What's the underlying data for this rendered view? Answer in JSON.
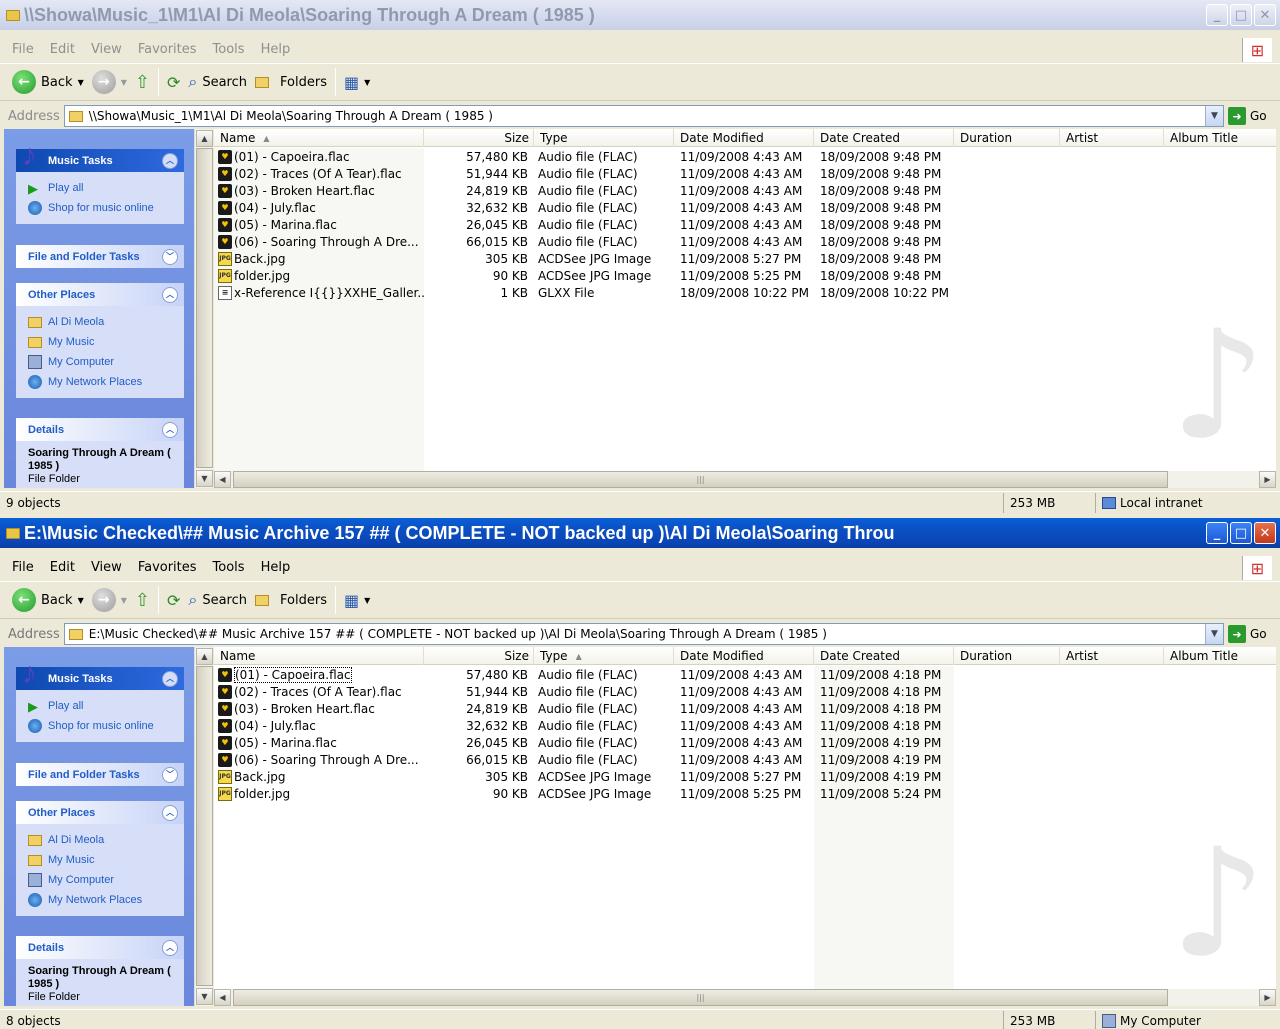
{
  "windows": [
    {
      "title": "\\\\Showa\\Music_1\\M1\\Al Di Meola\\Soaring Through A Dream  ( 1985 )",
      "state": "inactive",
      "menu": [
        "File",
        "Edit",
        "View",
        "Favorites",
        "Tools",
        "Help"
      ],
      "toolbar": {
        "back": "Back",
        "search": "Search",
        "folders": "Folders"
      },
      "address_label": "Address",
      "address": "\\\\Showa\\Music_1\\M1\\Al Di Meola\\Soaring Through A Dream  ( 1985 )",
      "go": "Go",
      "tasks": {
        "music_tasks": "Music Tasks",
        "play_all": "Play all",
        "shop": "Shop for music online",
        "file_folder_tasks": "File and Folder Tasks",
        "other_places": "Other Places",
        "places": [
          "Al Di Meola",
          "My Music",
          "My Computer",
          "My Network Places"
        ],
        "details": "Details",
        "detail_title": "Soaring Through A Dream  ( 1985 )",
        "detail_sub": "File Folder"
      },
      "columns": [
        "Name",
        "Size",
        "Type",
        "Date Modified",
        "Date Created",
        "Duration",
        "Artist",
        "Album Title"
      ],
      "files": [
        {
          "name": "(01) - Capoeira.flac",
          "size": "57,480 KB",
          "type": "Audio file (FLAC)",
          "modified": "11/09/2008 4:43 AM",
          "created": "18/09/2008 9:48 PM",
          "icon": "flac"
        },
        {
          "name": "(02) - Traces (Of A Tear).flac",
          "size": "51,944 KB",
          "type": "Audio file (FLAC)",
          "modified": "11/09/2008 4:43 AM",
          "created": "18/09/2008 9:48 PM",
          "icon": "flac"
        },
        {
          "name": "(03) - Broken Heart.flac",
          "size": "24,819 KB",
          "type": "Audio file (FLAC)",
          "modified": "11/09/2008 4:43 AM",
          "created": "18/09/2008 9:48 PM",
          "icon": "flac"
        },
        {
          "name": "(04) - July.flac",
          "size": "32,632 KB",
          "type": "Audio file (FLAC)",
          "modified": "11/09/2008 4:43 AM",
          "created": "18/09/2008 9:48 PM",
          "icon": "flac"
        },
        {
          "name": "(05) - Marina.flac",
          "size": "26,045 KB",
          "type": "Audio file (FLAC)",
          "modified": "11/09/2008 4:43 AM",
          "created": "18/09/2008 9:48 PM",
          "icon": "flac"
        },
        {
          "name": "(06) - Soaring Through A Dre...",
          "size": "66,015 KB",
          "type": "Audio file (FLAC)",
          "modified": "11/09/2008 4:43 AM",
          "created": "18/09/2008 9:48 PM",
          "icon": "flac"
        },
        {
          "name": "Back.jpg",
          "size": "305 KB",
          "type": "ACDSee JPG Image",
          "modified": "11/09/2008 5:27 PM",
          "created": "18/09/2008 9:48 PM",
          "icon": "jpg"
        },
        {
          "name": "folder.jpg",
          "size": "90 KB",
          "type": "ACDSee JPG Image",
          "modified": "11/09/2008 5:25 PM",
          "created": "18/09/2008 9:48 PM",
          "icon": "jpg"
        },
        {
          "name": "x-Reference I{{}}XXHE_Galler...",
          "size": "1 KB",
          "type": "GLXX File",
          "modified": "18/09/2008 10:22 PM",
          "created": "18/09/2008 10:22 PM",
          "icon": "doc"
        }
      ],
      "status": {
        "objects": "9 objects",
        "size": "253 MB",
        "zone": "Local intranet"
      }
    },
    {
      "title": "E:\\Music Checked\\## Music Archive 157 ## ( COMPLETE - NOT backed up )\\Al Di Meola\\Soaring Throu",
      "state": "active",
      "menu": [
        "File",
        "Edit",
        "View",
        "Favorites",
        "Tools",
        "Help"
      ],
      "toolbar": {
        "back": "Back",
        "search": "Search",
        "folders": "Folders"
      },
      "address_label": "Address",
      "address": "E:\\Music Checked\\## Music Archive 157 ## ( COMPLETE - NOT backed up )\\Al Di Meola\\Soaring Through A Dream  ( 1985 )",
      "go": "Go",
      "tasks": {
        "music_tasks": "Music Tasks",
        "play_all": "Play all",
        "shop": "Shop for music online",
        "file_folder_tasks": "File and Folder Tasks",
        "other_places": "Other Places",
        "places": [
          "Al Di Meola",
          "My Music",
          "My Computer",
          "My Network Places"
        ],
        "details": "Details",
        "detail_title": "Soaring Through A Dream  ( 1985 )",
        "detail_sub": "File Folder"
      },
      "columns": [
        "Name",
        "Size",
        "Type",
        "Date Modified",
        "Date Created",
        "Duration",
        "Artist",
        "Album Title"
      ],
      "files": [
        {
          "name": "(01) - Capoeira.flac",
          "size": "57,480 KB",
          "type": "Audio file (FLAC)",
          "modified": "11/09/2008 4:43 AM",
          "created": "11/09/2008 4:18 PM",
          "icon": "flac"
        },
        {
          "name": "(02) - Traces (Of A Tear).flac",
          "size": "51,944 KB",
          "type": "Audio file (FLAC)",
          "modified": "11/09/2008 4:43 AM",
          "created": "11/09/2008 4:18 PM",
          "icon": "flac"
        },
        {
          "name": "(03) - Broken Heart.flac",
          "size": "24,819 KB",
          "type": "Audio file (FLAC)",
          "modified": "11/09/2008 4:43 AM",
          "created": "11/09/2008 4:18 PM",
          "icon": "flac"
        },
        {
          "name": "(04) - July.flac",
          "size": "32,632 KB",
          "type": "Audio file (FLAC)",
          "modified": "11/09/2008 4:43 AM",
          "created": "11/09/2008 4:18 PM",
          "icon": "flac"
        },
        {
          "name": "(05) - Marina.flac",
          "size": "26,045 KB",
          "type": "Audio file (FLAC)",
          "modified": "11/09/2008 4:43 AM",
          "created": "11/09/2008 4:19 PM",
          "icon": "flac"
        },
        {
          "name": "(06) - Soaring Through A Dre...",
          "size": "66,015 KB",
          "type": "Audio file (FLAC)",
          "modified": "11/09/2008 4:43 AM",
          "created": "11/09/2008 4:19 PM",
          "icon": "flac"
        },
        {
          "name": "Back.jpg",
          "size": "305 KB",
          "type": "ACDSee JPG Image",
          "modified": "11/09/2008 5:27 PM",
          "created": "11/09/2008 4:19 PM",
          "icon": "jpg"
        },
        {
          "name": "folder.jpg",
          "size": "90 KB",
          "type": "ACDSee JPG Image",
          "modified": "11/09/2008 5:25 PM",
          "created": "11/09/2008 5:24 PM",
          "icon": "jpg"
        }
      ],
      "status": {
        "objects": "8 objects",
        "size": "253 MB",
        "zone": "My Computer"
      }
    }
  ]
}
